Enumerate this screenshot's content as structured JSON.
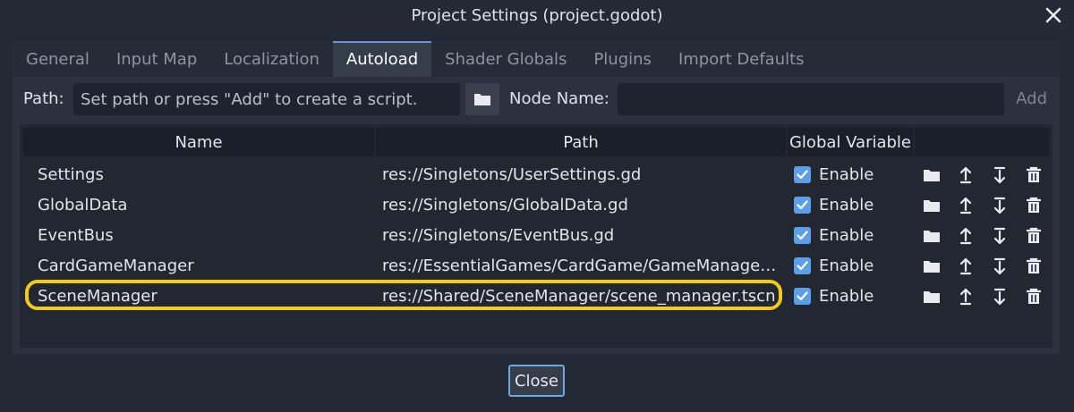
{
  "window": {
    "title": "Project Settings (project.godot)",
    "close_icon": "close-icon"
  },
  "tabs": [
    {
      "label": "General",
      "active": false
    },
    {
      "label": "Input Map",
      "active": false
    },
    {
      "label": "Localization",
      "active": false
    },
    {
      "label": "Autoload",
      "active": true
    },
    {
      "label": "Shader Globals",
      "active": false
    },
    {
      "label": "Plugins",
      "active": false
    },
    {
      "label": "Import Defaults",
      "active": false
    }
  ],
  "path_row": {
    "path_label": "Path:",
    "path_placeholder": "Set path or press \"Add\" to create a script.",
    "node_name_label": "Node Name:",
    "node_name_value": "",
    "add_label": "Add"
  },
  "table": {
    "headers": {
      "name": "Name",
      "path": "Path",
      "global": "Global Variable"
    },
    "rows": [
      {
        "name": "Settings",
        "path": "res://Singletons/UserSettings.gd",
        "enabled": true,
        "enable_label": "Enable"
      },
      {
        "name": "GlobalData",
        "path": "res://Singletons/GlobalData.gd",
        "enabled": true,
        "enable_label": "Enable"
      },
      {
        "name": "EventBus",
        "path": "res://Singletons/EventBus.gd",
        "enabled": true,
        "enable_label": "Enable"
      },
      {
        "name": "CardGameManager",
        "path": "res://EssentialGames/CardGame/GameManager/…",
        "enabled": true,
        "enable_label": "Enable"
      },
      {
        "name": "SceneManager",
        "path": "res://Shared/SceneManager/scene_manager.tscn",
        "enabled": true,
        "enable_label": "Enable"
      }
    ],
    "row_icons": [
      "folder-icon",
      "move-up-icon",
      "move-down-icon",
      "trash-icon"
    ]
  },
  "footer": {
    "close_label": "Close"
  },
  "colors": {
    "accent": "#5c9fe6",
    "highlight": "#f2cb1a"
  }
}
